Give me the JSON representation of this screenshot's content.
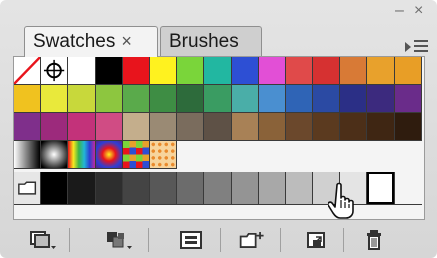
{
  "tabs": {
    "swatches_label": "Swatches",
    "close_glyph": "×",
    "brushes_label": "Brushes"
  },
  "window": {
    "minimize_glyph": "–",
    "close_glyph": "×"
  },
  "swatch_rows": [
    [
      "none",
      "registration",
      "#ffffff",
      "#000000",
      "#e8141c",
      "#fff21f",
      "#7ad53a",
      "#22b7a1",
      "#2d4fd4",
      "#e24fd6",
      "#e04a4a",
      "#d63131",
      "#d87a36",
      "#e8a12c",
      "#e89e26"
    ],
    [
      "#f0c21f",
      "#e9e93b",
      "#c8d83b",
      "#8dc63f",
      "#5aaa4b",
      "#3e8d44",
      "#2d6b3b",
      "#3a9c62",
      "#4aaea8",
      "#4a8fd0",
      "#2f64b6",
      "#2b4aa3",
      "#2b2f86",
      "#3c2a7e",
      "#6a2c8a"
    ],
    [
      "#7f2f8b",
      "#9c2a7c",
      "#c3327a",
      "#d04c84",
      "#c4ae8c",
      "#9a8a74",
      "#7a6c5d",
      "#5e5146",
      "#a88156",
      "#8a6239",
      "#6b482c",
      "#5b3a1f",
      "#4c2f18",
      "#3f2613",
      "#2f1c0e"
    ],
    [
      "gradient-gray",
      "gradient-radial",
      "gradient-spectrum",
      "gradient-radial-color",
      "pattern-squares",
      "pattern-dots"
    ]
  ],
  "gray_row": [
    "folder",
    "#000000",
    "#1a1a1a",
    "#2e2e2e",
    "#444444",
    "#585858",
    "#6c6c6c",
    "#808080",
    "#949494",
    "#a8a8a8",
    "#bcbcbc",
    "#d0d0d0",
    "#e4e4e4",
    "selected-white",
    "empty"
  ],
  "toolbar_icons": [
    "swatch-libraries-icon",
    "show-kinds-icon",
    "swatch-options-icon",
    "new-color-group-icon",
    "new-swatch-icon",
    "delete-swatch-icon"
  ]
}
